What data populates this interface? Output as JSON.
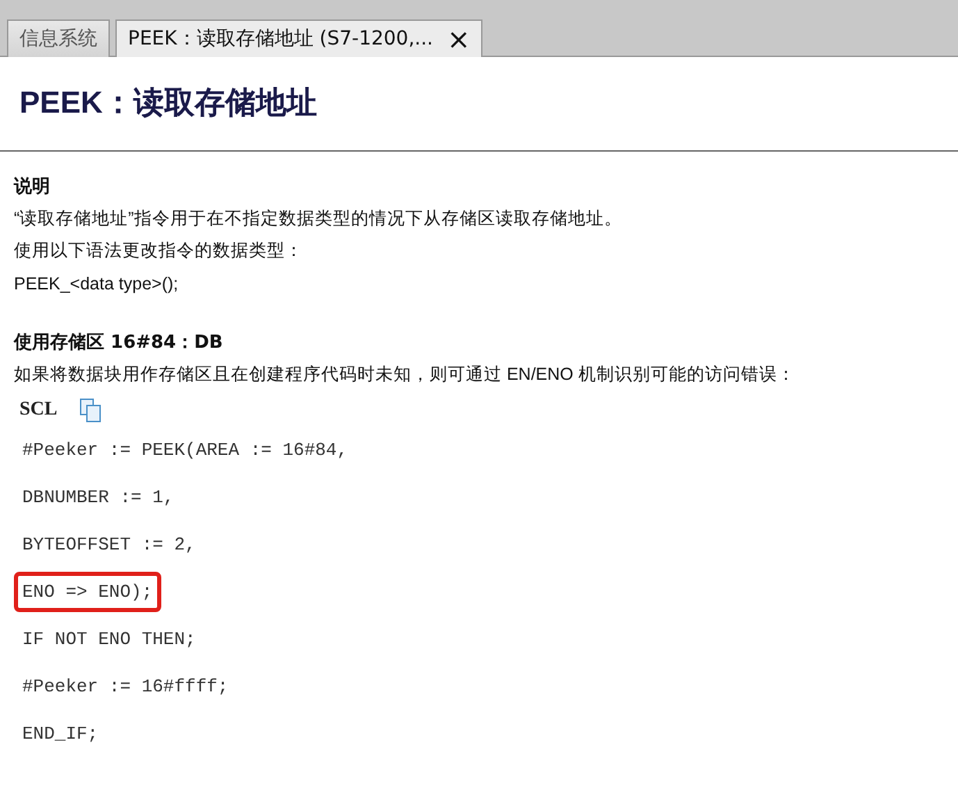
{
  "tabs": [
    {
      "label": "信息系统",
      "selected": false,
      "closable": false
    },
    {
      "label": "PEEK：读取存储地址 (S7-1200,...",
      "selected": true,
      "closable": true,
      "close_glyph": "×"
    }
  ],
  "page_title": "PEEK：读取存储地址",
  "sections": [
    {
      "heading": "说明",
      "paragraphs": [
        "“读取存储地址”指令用于在不指定数据类型的情况下从存储区读取存储地址。",
        "使用以下语法更改指令的数据类型：",
        "PEEK_<data type>();"
      ]
    },
    {
      "heading": "使用存储区 16#84：DB",
      "paragraphs": [
        "如果将数据块用作存储区且在创建程序代码时未知，则可通过 EN/ENO 机制识别可能的访问错误："
      ],
      "code": {
        "language": "SCL",
        "lines": [
          {
            "text": "#Peeker := PEEK(AREA := 16#84,",
            "highlighted": false
          },
          {
            "text": "DBNUMBER := 1,",
            "highlighted": false
          },
          {
            "text": "BYTEOFFSET := 2,",
            "highlighted": false
          },
          {
            "text": "ENO => ENO);",
            "highlighted": true
          },
          {
            "text": "IF NOT ENO THEN;",
            "highlighted": false
          },
          {
            "text": "#Peeker := 16#ffff;",
            "highlighted": false
          },
          {
            "text": "END_IF;",
            "highlighted": false
          }
        ]
      }
    }
  ]
}
